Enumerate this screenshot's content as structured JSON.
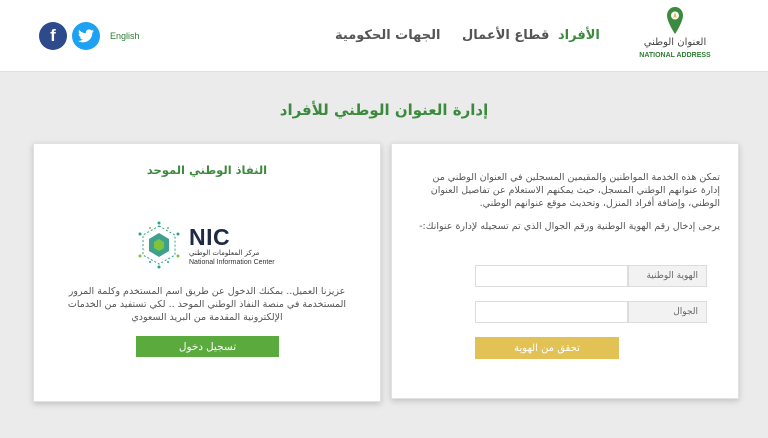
{
  "header": {
    "language_link": "English",
    "social": {
      "facebook_glyph": "f",
      "facebook_color": "#2d4a8a",
      "twitter_color": "#1da1f2"
    },
    "nav": {
      "individuals": "الأفراد",
      "business": "قطاع الأعمال",
      "government": "الجهات الحكومية"
    },
    "logo": {
      "arabic": "العنوان الوطني",
      "english": "NATIONAL ADDRESS"
    }
  },
  "page_title": "إدارة العنوان الوطني للأفراد",
  "nafath": {
    "title": "النفاذ الوطني الموحد",
    "nic_text": "NIC",
    "nic_arabic": "مركز المعلومات الوطني",
    "nic_english": "National Information Center",
    "description": "عزيزنا العميل.. بمكنك الدخول عن طريق اسم المستخدم وكلمة المرور المستخدمة في منصة النفاذ الوطني الموحد .. لكي تستفيد من الخدمات الإلكترونية المقدمة من البريد السعودي",
    "login_button": "تسجيل دخول"
  },
  "verification": {
    "info_text": "تمكن هذه الخدمة المواطنين والمقيمين المسجلين في العنوان الوطني من إدارة عنوانهم الوطني المسجل، حيث يمكنهم الاستعلام عن تفاصيل العنوان الوطني، وإضافة أفراد المنزل، وتحديث موقع عنوانهم الوطني.",
    "enter_text": "يرجى إدخال رقم الهوية الوطنية ورقم الجوال الذي تم تسجيله لإدارة عنوانك:-",
    "id_label": "الهوية الوطنية",
    "mobile_label": "الجوال",
    "verify_button": "تحقق من الهوية"
  },
  "colors": {
    "brand_green": "#3c8a3e",
    "button_green": "#5aaa3e",
    "button_gold": "#e3c255"
  }
}
